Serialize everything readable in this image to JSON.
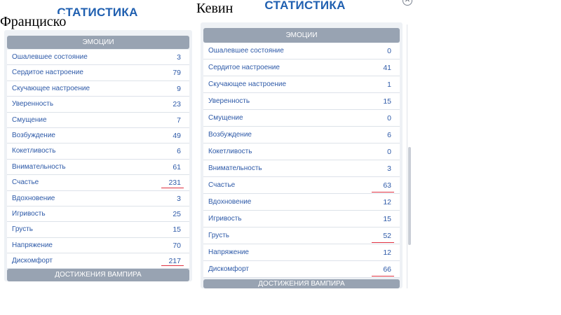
{
  "captions": {
    "left": "Франциско",
    "right": "Кевин"
  },
  "left_panel": {
    "title": "СТАТИСТИКА",
    "section": "ЭМОЦИИ",
    "footer_section": "ДОСТИЖЕНИЯ ВАМПИРА",
    "rows": [
      {
        "label": "Ошалевшее состояние",
        "value": "3"
      },
      {
        "label": "Сердитое настроение",
        "value": "79"
      },
      {
        "label": "Скучающее настроение",
        "value": "9"
      },
      {
        "label": "Уверенность",
        "value": "23"
      },
      {
        "label": "Смущение",
        "value": "7"
      },
      {
        "label": "Возбуждение",
        "value": "49"
      },
      {
        "label": "Кокетливость",
        "value": "6"
      },
      {
        "label": "Внимательность",
        "value": "61"
      },
      {
        "label": "Счастье",
        "value": "231",
        "underlined": true
      },
      {
        "label": "Вдохновение",
        "value": "3"
      },
      {
        "label": "Игривость",
        "value": "25"
      },
      {
        "label": "Грусть",
        "value": "15"
      },
      {
        "label": "Напряжение",
        "value": "70"
      },
      {
        "label": "Дискомфорт",
        "value": "217",
        "underlined": true
      }
    ]
  },
  "right_panel": {
    "title": "СТАТИСТИКА",
    "section": "ЭМОЦИИ",
    "footer_section": "ДОСТИЖЕНИЯ ВАМПИРА",
    "close_glyph": "✕",
    "rows": [
      {
        "label": "Ошалевшее состояние",
        "value": "0"
      },
      {
        "label": "Сердитое настроение",
        "value": "41"
      },
      {
        "label": "Скучающее настроение",
        "value": "1"
      },
      {
        "label": "Уверенность",
        "value": "15"
      },
      {
        "label": "Смущение",
        "value": "0"
      },
      {
        "label": "Возбуждение",
        "value": "6"
      },
      {
        "label": "Кокетливость",
        "value": "0"
      },
      {
        "label": "Внимательность",
        "value": "3"
      },
      {
        "label": "Счастье",
        "value": "63",
        "underlined": true
      },
      {
        "label": "Вдохновение",
        "value": "12"
      },
      {
        "label": "Игривость",
        "value": "15"
      },
      {
        "label": "Грусть",
        "value": "52",
        "underlined": true
      },
      {
        "label": "Напряжение",
        "value": "12"
      },
      {
        "label": "Дискомфорт",
        "value": "66",
        "underlined": true
      }
    ]
  },
  "colors": {
    "title": "#1f5fb0",
    "text": "#2e5aa8",
    "header_bg": "#98a3b2",
    "underline": "#e03040"
  }
}
